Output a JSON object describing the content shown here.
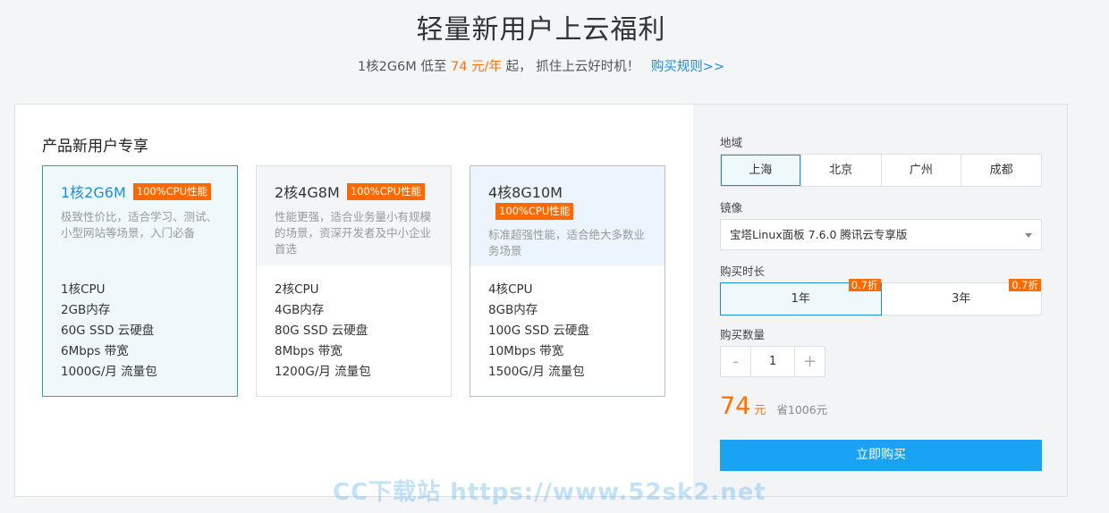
{
  "header": {
    "title": "轻量新用户上云福利",
    "subtitle_prefix": "1核2G6M 低至",
    "subtitle_price": "74 元/年",
    "subtitle_suffix": "起， 抓住上云好时机！",
    "rules_link": "购买规则>>"
  },
  "plans": {
    "section_title": "产品新用户专享",
    "badge": "100%CPU性能",
    "items": [
      {
        "name": "1核2G6M",
        "desc": "极致性价比，适合学习、测试、小型网站等场景，入门必备",
        "specs": [
          "1核CPU",
          "2GB内存",
          "60G SSD 云硬盘",
          "6Mbps 带宽",
          "1000G/月 流量包"
        ]
      },
      {
        "name": "2核4G8M",
        "desc": "性能更强，适合业务量小有规模的场景，资深开发者及中小企业首选",
        "specs": [
          "2核CPU",
          "4GB内存",
          "80G SSD 云硬盘",
          "8Mbps 带宽",
          "1200G/月 流量包"
        ]
      },
      {
        "name": "4核8G10M",
        "desc": "标准超强性能，适合绝大多数业务场景",
        "specs": [
          "4核CPU",
          "8GB内存",
          "100G SSD 云硬盘",
          "10Mbps 带宽",
          "1500G/月 流量包"
        ]
      }
    ]
  },
  "order": {
    "region_label": "地域",
    "regions": [
      "上海",
      "北京",
      "广州",
      "成都"
    ],
    "image_label": "镜像",
    "image_value": "宝塔Linux面板 7.6.0 腾讯云专享版",
    "duration_label": "购买时长",
    "durations": [
      {
        "label": "1年",
        "discount": "0.7折"
      },
      {
        "label": "3年",
        "discount": "0.7折"
      }
    ],
    "quantity_label": "购买数量",
    "quantity_minus": "-",
    "quantity_value": "1",
    "quantity_plus": "+",
    "price": "74",
    "price_unit": "元",
    "savings": "省1006元",
    "buy_button": "立即购买"
  },
  "watermark": "CC下载站 https://www.52sk2.net",
  "colors": {
    "accent": "#1c8ed9",
    "orange": "#ff7200",
    "badge": "#ff6a00",
    "buy_button": "#1aa3f5"
  }
}
